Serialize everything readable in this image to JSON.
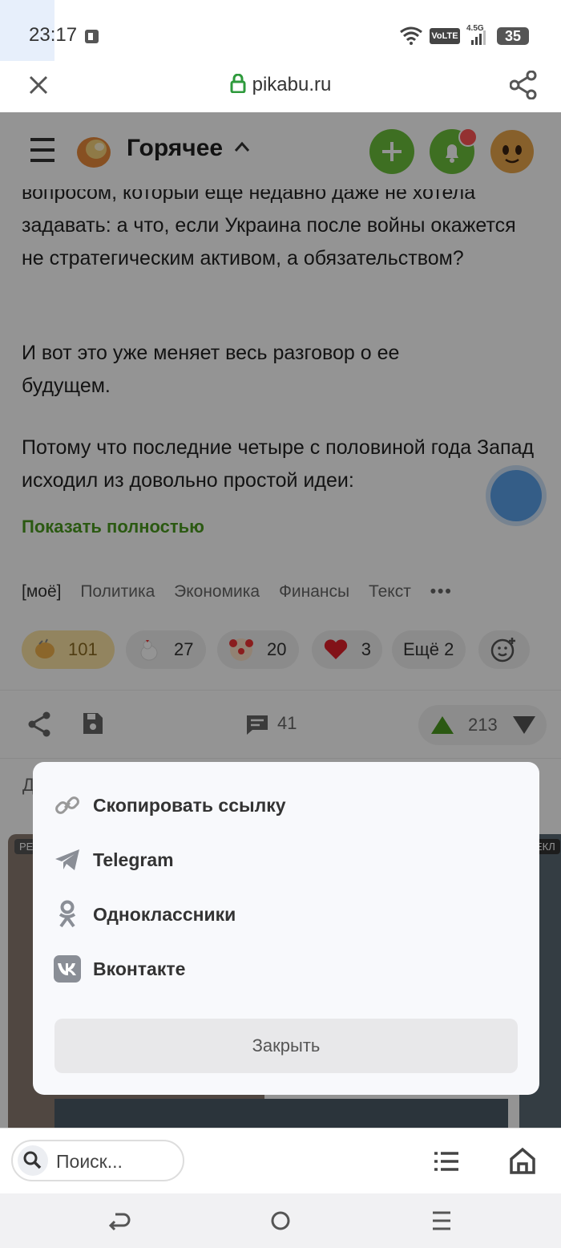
{
  "status_bar": {
    "time": "23:17",
    "volte": "VoLTE",
    "network": "4.5G",
    "battery": "35"
  },
  "browser": {
    "url": "pikabu.ru"
  },
  "site_header": {
    "title": "Горячее"
  },
  "article": {
    "paragraphs": [
      "вопросом, который еще недавно даже не хотела задавать: а что, если Украина после войны окажется не стратегическим активом, а обязательством?",
      "И вот это уже меняет весь разговор о ее будущем.",
      "Потому что последние четыре с половиной года Запад исходил из довольно простой идеи:"
    ],
    "show_more": "Показать полностью",
    "tags": [
      "[моё]",
      "Политика",
      "Экономика",
      "Финансы",
      "Текст"
    ],
    "reactions": [
      {
        "count": "101",
        "active": true
      },
      {
        "count": "27"
      },
      {
        "count": "20"
      },
      {
        "count": "3"
      }
    ],
    "more_reactions": "Ещё 2",
    "comments_count": "41",
    "rating": "213"
  },
  "share_dialog": {
    "items": [
      {
        "label": "Скопировать ссылку",
        "icon": "link-icon"
      },
      {
        "label": "Telegram",
        "icon": "telegram-icon"
      },
      {
        "label": "Одноклассники",
        "icon": "odnoklassniki-icon"
      },
      {
        "label": "Вконтакте",
        "icon": "vk-icon"
      }
    ],
    "close_label": "Закрыть"
  },
  "bottom_bar": {
    "search_placeholder": "Поиск..."
  },
  "colors": {
    "accent_green": "#6cbf3c",
    "link_green": "#4a9a1f",
    "overlay": "rgba(0,0,0,0.42)"
  }
}
